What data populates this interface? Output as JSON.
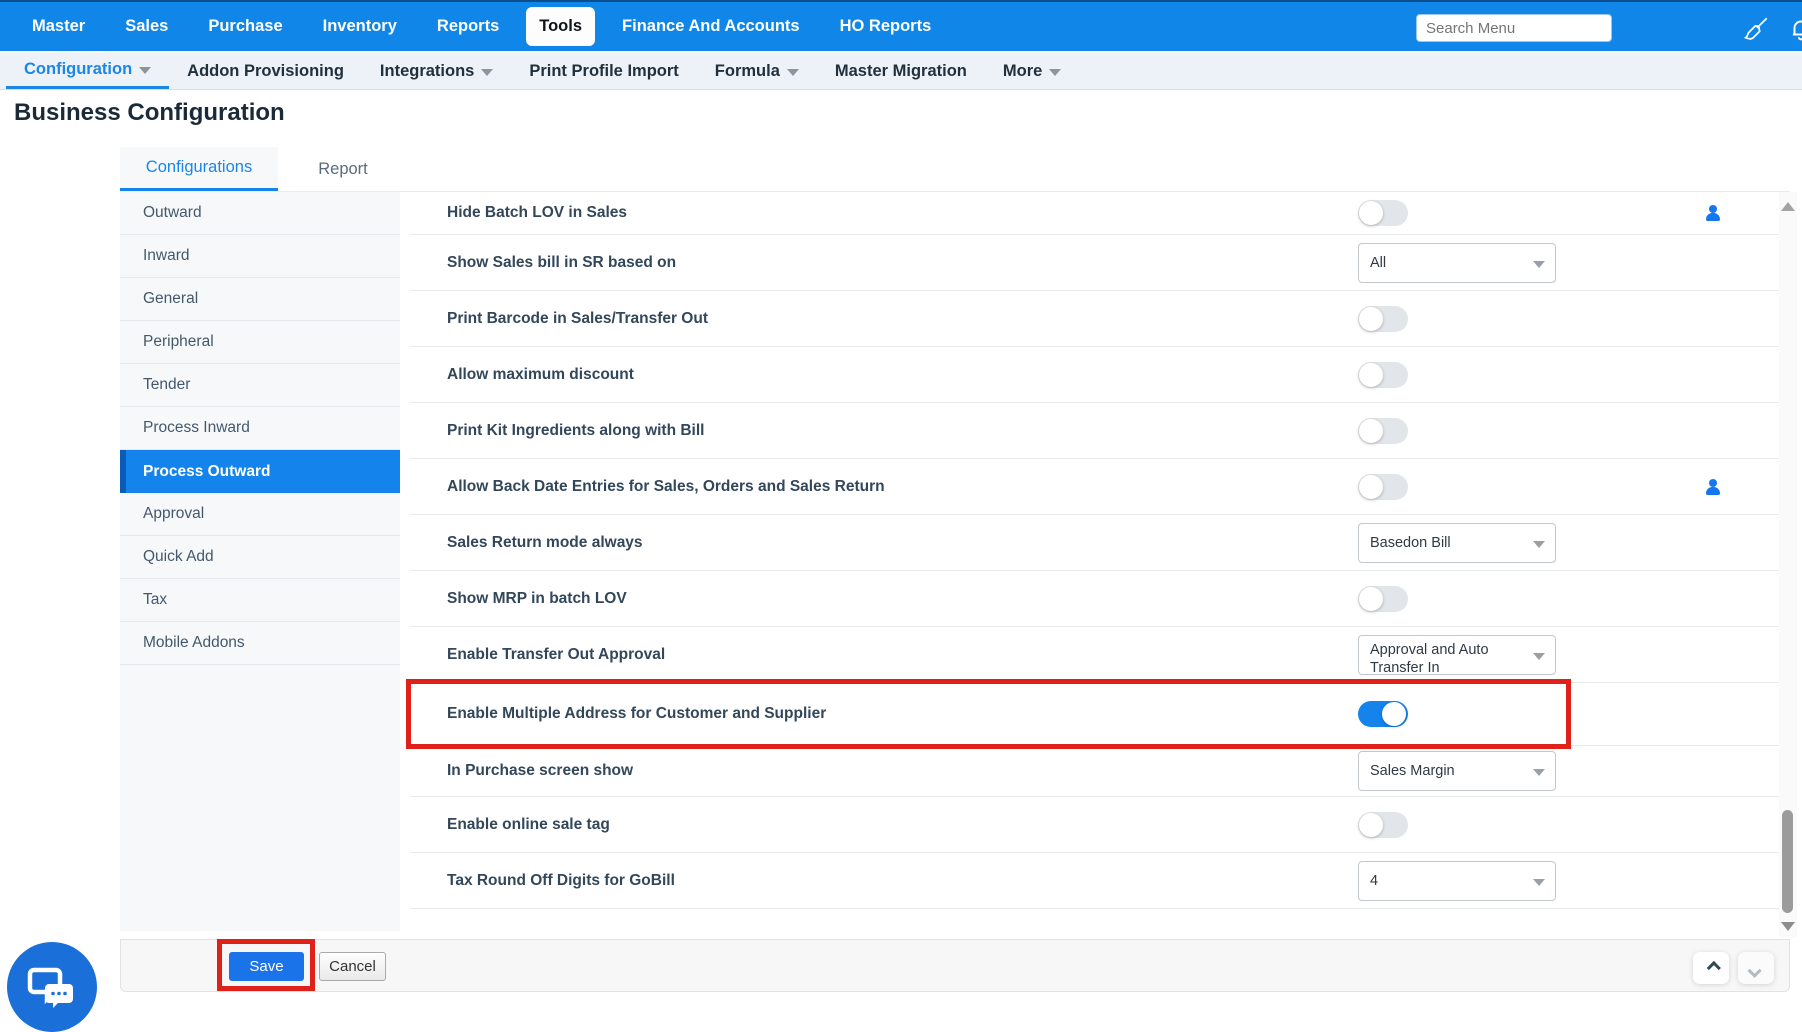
{
  "topbar": {
    "items": [
      "Master",
      "Sales",
      "Purchase",
      "Inventory",
      "Reports",
      "Tools",
      "Finance And Accounts",
      "HO Reports"
    ],
    "active_item": "Tools",
    "search_placeholder": "Search Menu",
    "icons": [
      "paintbrush-icon",
      "notification-bell-icon"
    ]
  },
  "subnav": {
    "items": [
      {
        "label": "Configuration",
        "caret": true,
        "active": true
      },
      {
        "label": "Addon Provisioning",
        "caret": false,
        "active": false
      },
      {
        "label": "Integrations",
        "caret": true,
        "active": false
      },
      {
        "label": "Print Profile Import",
        "caret": false,
        "active": false
      },
      {
        "label": "Formula",
        "caret": true,
        "active": false
      },
      {
        "label": "Master Migration",
        "caret": false,
        "active": false
      },
      {
        "label": "More",
        "caret": true,
        "active": false
      }
    ]
  },
  "page_title": "Business Configuration",
  "tabs": [
    {
      "label": "Configurations",
      "active": true
    },
    {
      "label": "Report",
      "active": false
    }
  ],
  "sidebar": {
    "items": [
      "Outward",
      "Inward",
      "General",
      "Peripheral",
      "Tender",
      "Process Inward",
      "Process Outward",
      "Approval",
      "Quick Add",
      "Tax",
      "Mobile Addons"
    ],
    "active_item": "Process Outward"
  },
  "settings_rows": [
    {
      "label": "Hide Batch LOV in Sales",
      "control": "toggle",
      "value": false,
      "user_icon": true,
      "highlighted": false
    },
    {
      "label": "Show Sales bill in SR based on",
      "control": "select",
      "value": "All",
      "user_icon": false,
      "highlighted": false
    },
    {
      "label": "Print Barcode in Sales/Transfer Out",
      "control": "toggle",
      "value": false,
      "user_icon": false,
      "highlighted": false
    },
    {
      "label": "Allow maximum discount",
      "control": "toggle",
      "value": false,
      "user_icon": false,
      "highlighted": false
    },
    {
      "label": "Print Kit Ingredients along with Bill",
      "control": "toggle",
      "value": false,
      "user_icon": false,
      "highlighted": false
    },
    {
      "label": "Allow Back Date Entries for Sales, Orders and Sales Return",
      "control": "toggle",
      "value": false,
      "user_icon": true,
      "highlighted": false
    },
    {
      "label": "Sales Return mode always",
      "control": "select",
      "value": "Basedon Bill",
      "user_icon": false,
      "highlighted": false
    },
    {
      "label": "Show MRP in batch LOV",
      "control": "toggle",
      "value": false,
      "user_icon": false,
      "highlighted": false
    },
    {
      "label": "Enable Transfer Out Approval",
      "control": "select",
      "value": "Approval and Auto Transfer In",
      "user_icon": false,
      "highlighted": false
    },
    {
      "label": "Enable Multiple Address for Customer and Supplier",
      "control": "toggle",
      "value": true,
      "user_icon": false,
      "highlighted": true
    },
    {
      "label": "In Purchase screen show",
      "control": "select",
      "value": "Sales Margin",
      "user_icon": false,
      "highlighted": false
    },
    {
      "label": "Enable online sale tag",
      "control": "toggle",
      "value": false,
      "user_icon": false,
      "highlighted": false
    },
    {
      "label": "Tax Round Off Digits for GoBill",
      "control": "select",
      "value": "4",
      "user_icon": false,
      "highlighted": false
    }
  ],
  "footer": {
    "save_label": "Save",
    "cancel_label": "Cancel"
  },
  "colors": {
    "topbar_blue": "#1086e8",
    "accent_blue": "#1583ec",
    "link_blue": "#1a87e8",
    "save_blue": "#1a73e8",
    "highlight_red": "#e0211a",
    "label_text": "#33475b"
  }
}
